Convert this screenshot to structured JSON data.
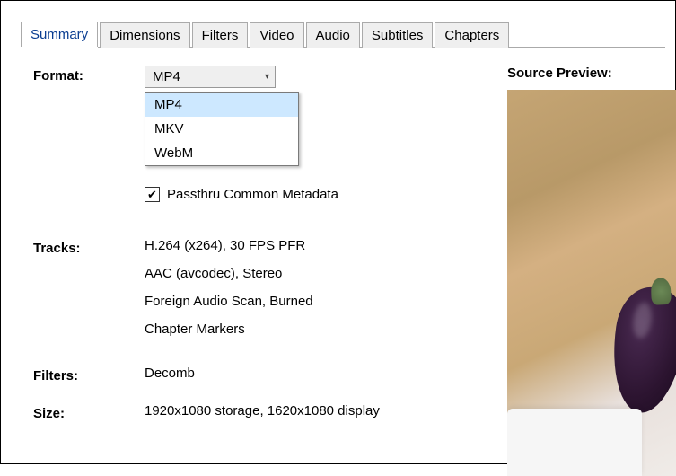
{
  "tabs": {
    "summary": "Summary",
    "dimensions": "Dimensions",
    "filters": "Filters",
    "video": "Video",
    "audio": "Audio",
    "subtitles": "Subtitles",
    "chapters": "Chapters"
  },
  "labels": {
    "format": "Format:",
    "tracks": "Tracks:",
    "filters": "Filters:",
    "size": "Size:",
    "preview": "Source Preview:"
  },
  "format": {
    "selected": "MP4",
    "options": [
      "MP4",
      "MKV",
      "WebM"
    ]
  },
  "passthru": {
    "checked": true,
    "label": "Passthru Common Metadata"
  },
  "tracks": [
    "H.264 (x264), 30 FPS PFR",
    "AAC (avcodec), Stereo",
    "Foreign Audio Scan, Burned",
    "Chapter Markers"
  ],
  "filters_value": "Decomb",
  "size_value": "1920x1080 storage, 1620x1080 display"
}
